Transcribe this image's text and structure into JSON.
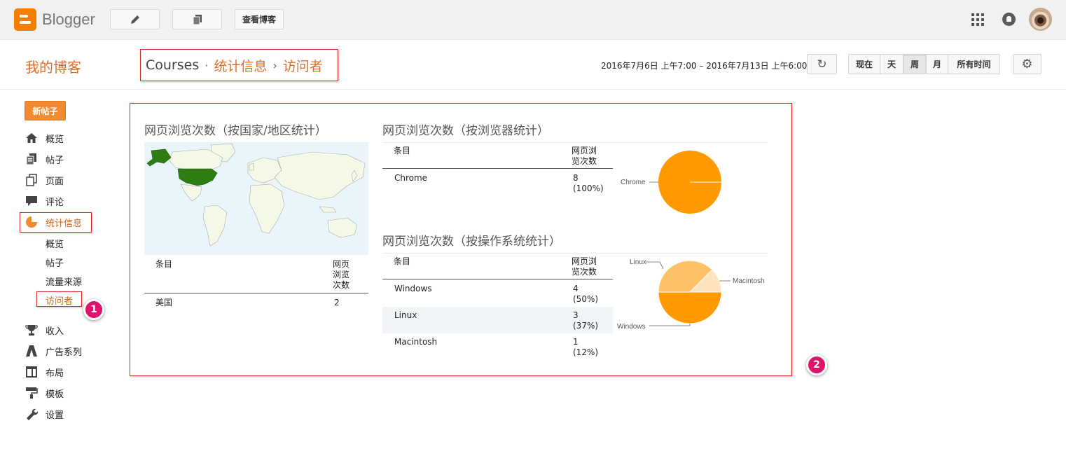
{
  "topbar": {
    "logo_text": "Blogger",
    "view_blog_label": "查看博客",
    "icons": [
      "pencil-icon",
      "pages-icon",
      "apps-grid-icon",
      "notification-icon"
    ]
  },
  "header": {
    "blog_name": "我的博客",
    "breadcrumb": {
      "blog": "Courses",
      "sep1": "·",
      "section": "统计信息",
      "sep2": "›",
      "page": "访问者"
    },
    "date_range": "2016年7月6日 上午7:00 – 2016年7月13日 上午6:00",
    "ranges": [
      {
        "label": "现在",
        "active": false
      },
      {
        "label": "天",
        "active": false
      },
      {
        "label": "周",
        "active": true
      },
      {
        "label": "月",
        "active": false
      },
      {
        "label": "所有时间",
        "active": false
      }
    ]
  },
  "sidebar": {
    "new_post": "新帖子",
    "items": [
      {
        "label": "概览",
        "icon": "home-icon"
      },
      {
        "label": "帖子",
        "icon": "posts-icon"
      },
      {
        "label": "页面",
        "icon": "pages-icon"
      },
      {
        "label": "评论",
        "icon": "comment-icon"
      },
      {
        "label": "统计信息",
        "icon": "stats-pie-icon",
        "active": true
      },
      {
        "label": "收入",
        "icon": "trophy-icon"
      },
      {
        "label": "广告系列",
        "icon": "adwords-icon"
      },
      {
        "label": "布局",
        "icon": "layout-icon"
      },
      {
        "label": "模板",
        "icon": "paint-roller-icon"
      },
      {
        "label": "设置",
        "icon": "wrench-icon"
      }
    ],
    "sub_items": [
      {
        "label": "概览",
        "active": false
      },
      {
        "label": "帖子",
        "active": false
      },
      {
        "label": "流量来源",
        "active": false
      },
      {
        "label": "访问者",
        "active": true
      }
    ]
  },
  "badges": [
    "1",
    "2"
  ],
  "stats": {
    "country": {
      "title": "网页浏览次数（按国家/地区统计）",
      "col_entry": "条目",
      "col_views": "网页浏览次数",
      "rows": [
        {
          "name": "美国",
          "views": "2"
        }
      ],
      "highlight_color": "#2e7d12"
    },
    "browser": {
      "title": "网页浏览次数（按浏览器统计）",
      "col_entry": "条目",
      "col_views": "网页浏览次数",
      "rows": [
        {
          "name": "Chrome",
          "count": "8",
          "pct": "(100%)"
        }
      ]
    },
    "os": {
      "title": "网页浏览次数（按操作系统统计）",
      "col_entry": "条目",
      "col_views": "网页浏览次数",
      "rows": [
        {
          "name": "Windows",
          "count": "4",
          "pct": "(50%)"
        },
        {
          "name": "Linux",
          "count": "3",
          "pct": "(37%)"
        },
        {
          "name": "Macintosh",
          "count": "1",
          "pct": "(12%)"
        }
      ]
    }
  },
  "chart_data": [
    {
      "type": "pie",
      "categories": [
        "Chrome"
      ],
      "values": [
        8
      ],
      "colors": [
        "#ff9900"
      ]
    },
    {
      "type": "pie",
      "categories": [
        "Windows",
        "Linux",
        "Macintosh"
      ],
      "values": [
        4,
        3,
        1
      ],
      "colors": [
        "#ff9900",
        "#ffc266",
        "#ffe5bf"
      ]
    }
  ]
}
